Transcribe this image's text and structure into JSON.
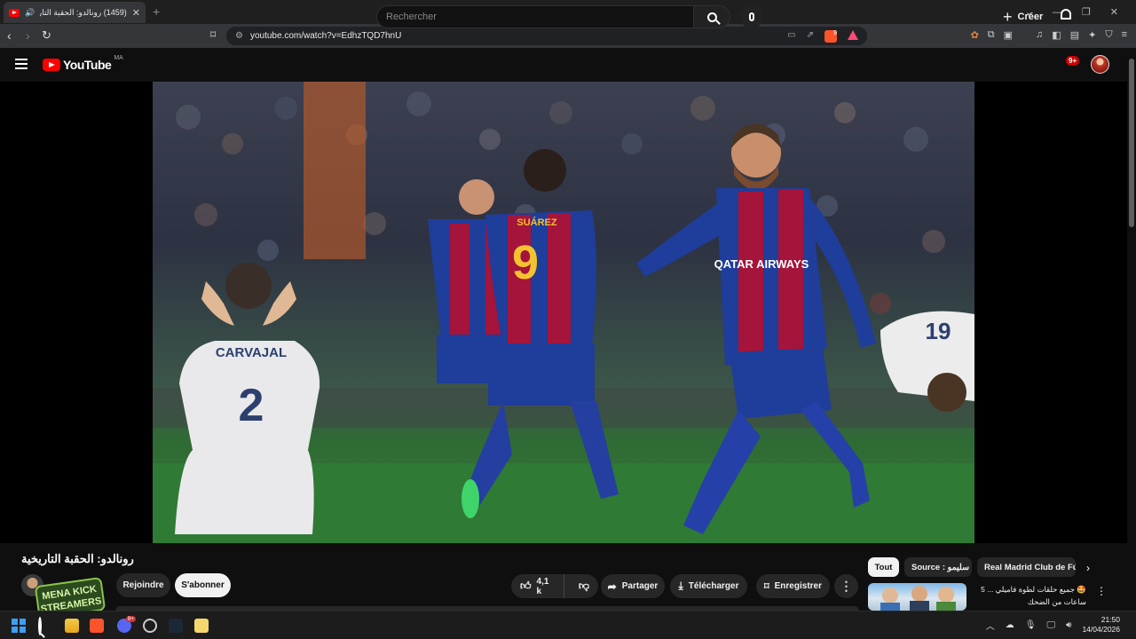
{
  "browser": {
    "tab_title": "(1459) رونالدو: الحقبة التاريخية",
    "new_tab": "+",
    "url": "youtube.com/watch?v=EdhzTQD7hnU",
    "brave_shields_count": "9"
  },
  "header": {
    "logo_text": "YouTube",
    "country_code": "MA",
    "search_placeholder": "Rechercher",
    "create_label": "Créer",
    "notifications_badge": "9+"
  },
  "video": {
    "title": "رونالدو: الحقبة التاريخية",
    "join_label": "Rejoindre",
    "subscribe_label": "S'abonner",
    "likes": "4,1 k",
    "share_label": "Partager",
    "download_label": "Télécharger",
    "save_label": "Enregistrer",
    "more_label": "⋮",
    "jersey_left": "CARVAJAL",
    "jersey_left_number": "2",
    "jersey_center": "SUÁREZ",
    "jersey_center_number": "9",
    "sponsor": "QATAR AIRWAYS",
    "jersey_right_number": "19",
    "channel_logo_line1": "MENA KICK",
    "channel_logo_line2": "STREAMERS"
  },
  "sidebar": {
    "chips": [
      "Tout",
      "Source : سليمو",
      "Real Madrid Club de Fútbol"
    ],
    "chips_next": "›",
    "rec_title": "🤩 جميع حلقات لطوة فاميلي ... 5 ساعات من الضحك",
    "rec_menu": "⋮"
  },
  "taskbar": {
    "discord_badge": "9+",
    "time": "21:50",
    "date": "14/04/2026"
  },
  "colors": {
    "youtube_red": "#ff0000",
    "background": "#0f0f0f",
    "barca_blue": "#1f3d9a",
    "barca_red": "#a5143a"
  }
}
